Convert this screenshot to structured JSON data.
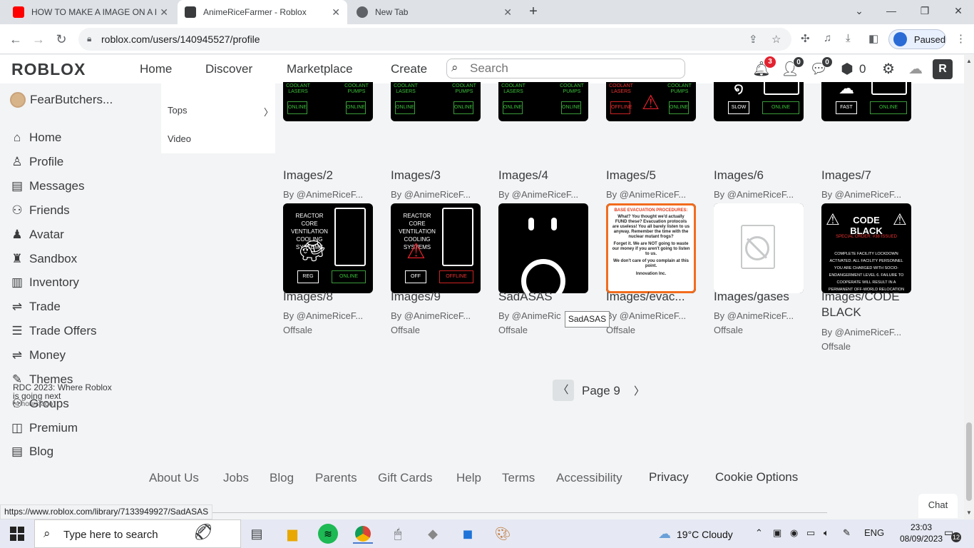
{
  "browser": {
    "tabs": [
      {
        "title": "HOW TO MAKE A IMAGE ON A P",
        "icon": "youtube-icon"
      },
      {
        "title": "AnimeRiceFarmer - Roblox",
        "icon": "roblox-icon"
      },
      {
        "title": "New Tab",
        "icon": "chrome-icon"
      }
    ],
    "url": "roblox.com/users/140945527/profile",
    "profile_label": "Paused"
  },
  "header": {
    "logo": "ROBLOX",
    "nav": [
      "Home",
      "Discover",
      "Marketplace",
      "Create"
    ],
    "search_placeholder": "Search",
    "notifications_count": "3",
    "friends_count": "0",
    "messages_count": "0",
    "robux": "0"
  },
  "sidebar": {
    "username": "FearButchers...",
    "items": [
      {
        "label": "Home",
        "icon": "home-icon"
      },
      {
        "label": "Profile",
        "icon": "profile-icon"
      },
      {
        "label": "Messages",
        "icon": "messages-icon"
      },
      {
        "label": "Friends",
        "icon": "friends-icon"
      },
      {
        "label": "Avatar",
        "icon": "avatar-icon"
      },
      {
        "label": "Sandbox",
        "icon": "sandbox-icon"
      },
      {
        "label": "Inventory",
        "icon": "inventory-icon"
      },
      {
        "label": "Trade",
        "icon": "trade-icon"
      },
      {
        "label": "Trade Offers",
        "icon": "trade-offers-icon"
      },
      {
        "label": "Money",
        "icon": "money-icon"
      },
      {
        "label": "Themes",
        "icon": "themes-icon"
      },
      {
        "label": "Groups",
        "icon": "groups-icon"
      },
      {
        "label": "Premium",
        "icon": "premium-icon"
      },
      {
        "label": "Blog",
        "icon": "blog-icon"
      }
    ],
    "news_title": "RDC 2023: Where Roblox is going next",
    "news_time": "(4 hours ago)"
  },
  "category_menu": {
    "items": [
      "Tops",
      "Video"
    ]
  },
  "items": [
    {
      "name": "Images/2",
      "creator": "By @AnimeRiceF...",
      "price": "Offsale"
    },
    {
      "name": "Images/3",
      "creator": "By @AnimeRiceF...",
      "price": "Offsale"
    },
    {
      "name": "Images/4",
      "creator": "By @AnimeRiceF...",
      "price": "Offsale"
    },
    {
      "name": "Images/5",
      "creator": "By @AnimeRiceF...",
      "price": "Offsale"
    },
    {
      "name": "Images/6",
      "creator": "By @AnimeRiceF...",
      "price": "Offsale"
    },
    {
      "name": "Images/7",
      "creator": "By @AnimeRiceF...",
      "price": "Offsale"
    },
    {
      "name": "Images/8",
      "creator": "By @AnimeRiceF...",
      "price": "Offsale"
    },
    {
      "name": "Images/9",
      "creator": "By @AnimeRiceF...",
      "price": "Offsale"
    },
    {
      "name": "SadASAS",
      "creator": "By @AnimeRic",
      "price": "Offsale"
    },
    {
      "name": "Images/evac...",
      "creator": "By @AnimeRiceF...",
      "price": "Offsale"
    },
    {
      "name": "Images/gases",
      "creator": "By @AnimeRiceF...",
      "price": "Offsale"
    },
    {
      "name": "Images/CODE BLACK",
      "creator": "By @AnimeRiceF...",
      "price": "Offsale"
    }
  ],
  "thumb_text": {
    "coolant_lasers": "COOLANT LASERS",
    "coolant_pumps": "COOLANT PUMPS",
    "online": "ONLINE",
    "offline": "OFFLINE",
    "slow": "SLOW",
    "fast": "FAST",
    "reactor": "REACTOR CORE VENTILATION COOLING SYSTEMS",
    "reg": "REG",
    "off": "OFF",
    "evac_heading": "BASE EVACUATION PROCEDURES:",
    "evac_body1": "What? You thought we'd actually FUND these? Evacuation protocols are useless! You all barely listen to us anyway. Remember the time with the nuclear mutant frogs?",
    "evac_body2": "Forget it. We are NOT going to waste our money if you aren't going to listen to us.",
    "evac_body3": "We don't care of you complain at this point.",
    "evac_footer": "Innovation Inc.",
    "code_black": "CODE BLACK",
    "special_order": "SPECIAL ORDER: #38 ISSUED",
    "code_black_body": "COMPLETE FACILITY LOCKDOWN ACTIVATED. ALL FACILITY PERSONNEL YOU ARE CHARGED WITH SOCIO-ENDANGERMENT LEVEL 6. FAILURE TO COOPERATE WILL RESULT IN A PERMANENT OFF-WORLD RELOCATION"
  },
  "tooltip": "SadASAS",
  "pager": {
    "label": "Page 9"
  },
  "footer": {
    "links": [
      "About Us",
      "Jobs",
      "Blog",
      "Parents",
      "Gift Cards",
      "Help",
      "Terms",
      "Accessibility",
      "Privacy",
      "Cookie Options"
    ]
  },
  "chat_label": "Chat",
  "status_url": "https://www.roblox.com/library/7133949927/SadASAS",
  "taskbar": {
    "search_placeholder": "Type here to search",
    "weather": "19°C  Cloudy",
    "language": "ENG",
    "time": "23:03",
    "date": "08/09/2023",
    "notifications": "12"
  }
}
